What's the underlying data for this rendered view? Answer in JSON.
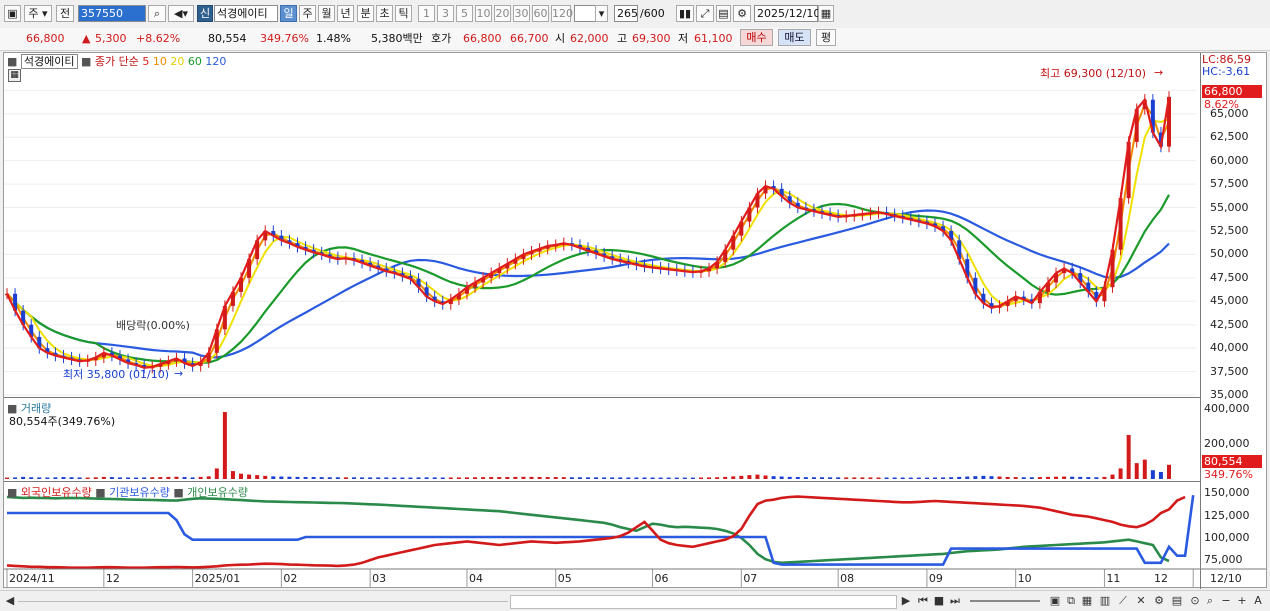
{
  "toolbar": {
    "type_label": "주",
    "prev_label": "전",
    "code_value": "357550",
    "sin_label": "신",
    "stock_name": "석경에이티",
    "periods": [
      "일",
      "주",
      "월",
      "년",
      "분",
      "초",
      "틱"
    ],
    "minutes": [
      "1",
      "3",
      "5",
      "10",
      "20",
      "30",
      "60",
      "120"
    ],
    "count_value": "265",
    "count_max": "/600",
    "date_value": "2025/12/10"
  },
  "quote": {
    "price": "66,800",
    "change": "5,300",
    "change_pct": "+8.62%",
    "volume": "80,554",
    "volume_ratio": "349.76%",
    "turnover_pct": "1.48%",
    "amount": "5,380백만",
    "hoga_label": "호가",
    "ask": "66,800",
    "bid": "66,700",
    "open_label": "시",
    "open": "62,000",
    "high_label": "고",
    "high": "69,300",
    "low_label": "저",
    "low": "61,100",
    "buy_label": "매수",
    "sell_label": "매도",
    "eval_label": "평"
  },
  "price_panel": {
    "title": "석경에이티",
    "ma_label": "종가 단순",
    "ma_periods": [
      "5",
      "10",
      "20",
      "60",
      "120"
    ],
    "ma_colors": [
      "#e01c1c",
      "#f08a00",
      "#f0e000",
      "#1a9a2a",
      "#2a5ae0"
    ],
    "lc_label": "LC:86,59",
    "hc_label": "HC:-3,61",
    "last_price_tag": "66,800",
    "last_pct_tag": "8.62%",
    "high_annotation": "최고 69,300 (12/10)",
    "low_annotation": "최저 35,800 (01/10)",
    "dividend_annotation": "배당락(0.00%)",
    "y_ticks": [
      "67,500",
      "65,000",
      "62,500",
      "60,000",
      "57,500",
      "55,000",
      "52,500",
      "50,000",
      "47,500",
      "45,000",
      "42,500",
      "40,000",
      "37,500",
      "35,000"
    ]
  },
  "volume_panel": {
    "title": "거래량",
    "value_label": "80,554주(349.76%)",
    "y_ticks": [
      "400,000",
      "200,000"
    ],
    "last_tag": "80,554",
    "last_pct_tag": "349.76%"
  },
  "holding_panel": {
    "legend": [
      "외국인보유수량",
      "기관보유수량",
      "개인보유수량"
    ],
    "colors": [
      "#d21a1a",
      "#2a5ae0",
      "#2a8a4a"
    ],
    "y_ticks": [
      "150,000",
      "125,000",
      "100,000",
      "75,000"
    ]
  },
  "x_axis": [
    "2024/11",
    "12",
    "2025/01",
    "02",
    "03",
    "04",
    "05",
    "06",
    "07",
    "08",
    "09",
    "10",
    "11",
    "12",
    "12/10"
  ],
  "chart_data": {
    "type": "line",
    "price_range": [
      35000,
      68500
    ],
    "volume_range": [
      0,
      420000
    ],
    "holding_range": [
      65000,
      155000
    ],
    "close": [
      45800,
      44000,
      42500,
      41200,
      40000,
      39500,
      39200,
      39000,
      38800,
      38600,
      38700,
      39000,
      39500,
      39200,
      38800,
      38400,
      38200,
      37900,
      38000,
      38300,
      38600,
      38900,
      38400,
      38100,
      38500,
      39500,
      42000,
      44500,
      46000,
      47500,
      49500,
      51500,
      52500,
      52000,
      51500,
      51200,
      50800,
      50500,
      50200,
      50000,
      49700,
      49500,
      49600,
      49400,
      49100,
      48800,
      48500,
      48200,
      48000,
      47700,
      47400,
      46500,
      45500,
      45000,
      44700,
      45200,
      45800,
      46500,
      47000,
      47500,
      48000,
      48500,
      49000,
      49500,
      50000,
      50300,
      50600,
      50900,
      51000,
      51200,
      51000,
      50700,
      50400,
      50100,
      49800,
      49500,
      49300,
      49100,
      48900,
      48700,
      48600,
      48500,
      48400,
      48300,
      48200,
      48100,
      48200,
      48500,
      49200,
      50500,
      52000,
      53500,
      55000,
      56500,
      57300,
      57000,
      56200,
      55500,
      55000,
      54800,
      54600,
      54400,
      54200,
      54000,
      54100,
      54200,
      54300,
      54400,
      54500,
      54300,
      54100,
      53900,
      53700,
      53500,
      53300,
      53000,
      52500,
      51500,
      49500,
      47500,
      45800,
      44800,
      44300,
      44500,
      45000,
      45500,
      45200,
      44800,
      46000,
      47000,
      48000,
      48500,
      48000,
      47000,
      46000,
      45000,
      46500,
      50500,
      56000,
      62000,
      65500,
      66500,
      63000,
      61500,
      66800
    ],
    "volume": [
      8000,
      9000,
      12000,
      10000,
      9000,
      8500,
      9500,
      11000,
      10000,
      9000,
      8000,
      9500,
      12000,
      11000,
      9000,
      8500,
      8000,
      9000,
      10000,
      11000,
      12000,
      13000,
      11000,
      9000,
      12000,
      15000,
      60000,
      380000,
      45000,
      30000,
      25000,
      22000,
      18000,
      15000,
      14000,
      13000,
      12000,
      11000,
      11000,
      10500,
      10000,
      10000,
      9500,
      9500,
      9000,
      9000,
      9000,
      9000,
      8500,
      8500,
      8500,
      9000,
      9500,
      9000,
      8500,
      8500,
      9000,
      9500,
      10000,
      10500,
      11000,
      11000,
      11500,
      12000,
      12500,
      12000,
      11500,
      11000,
      11000,
      10500,
      10000,
      10000,
      9500,
      9500,
      9000,
      9000,
      9000,
      8500,
      8500,
      8500,
      8500,
      8000,
      8000,
      8000,
      8000,
      8000,
      8500,
      9000,
      10000,
      12000,
      15000,
      18000,
      22000,
      25000,
      20000,
      16000,
      14000,
      12000,
      11000,
      10500,
      10000,
      10000,
      9500,
      9500,
      9000,
      9000,
      9000,
      9000,
      8500,
      8500,
      8500,
      8500,
      8000,
      8000,
      8000,
      8500,
      9000,
      10000,
      12000,
      14000,
      16000,
      18000,
      16000,
      14000,
      12000,
      11000,
      10000,
      10000,
      11000,
      12000,
      13000,
      14000,
      13000,
      12000,
      11000,
      10000,
      12000,
      25000,
      60000,
      250000,
      90000,
      110000,
      50000,
      40000,
      80554
    ],
    "foreign": [
      69000,
      68500,
      68000,
      67500,
      67500,
      67000,
      67000,
      66800,
      66500,
      66500,
      66500,
      66800,
      67000,
      67000,
      66800,
      66500,
      66500,
      66500,
      66800,
      67000,
      67000,
      67200,
      67000,
      66800,
      67000,
      67500,
      68000,
      69000,
      69500,
      69800,
      70000,
      70500,
      71000,
      70800,
      70500,
      70000,
      69800,
      69500,
      69200,
      69000,
      68800,
      68500,
      69000,
      70000,
      72000,
      75000,
      78000,
      80000,
      82000,
      84000,
      86000,
      88000,
      90000,
      92000,
      93000,
      94000,
      95000,
      96000,
      95000,
      94000,
      93000,
      92000,
      93000,
      94000,
      95000,
      96000,
      95500,
      95000,
      94500,
      95000,
      95500,
      96000,
      97000,
      98000,
      99000,
      100000,
      102000,
      106000,
      112000,
      118000,
      108000,
      98000,
      94000,
      92000,
      91000,
      90000,
      92000,
      94000,
      96000,
      98000,
      102000,
      110000,
      125000,
      138000,
      142000,
      143000,
      145000,
      146000,
      146500,
      146000,
      145500,
      145000,
      144500,
      144000,
      143500,
      143000,
      142500,
      142000,
      141500,
      141000,
      140500,
      140000,
      140000,
      140500,
      141000,
      141500,
      141000,
      140500,
      140000,
      139500,
      139000,
      138500,
      138000,
      137500,
      137000,
      136500,
      136000,
      135000,
      134000,
      132000,
      130000,
      128000,
      126000,
      125000,
      124000,
      122000,
      120000,
      118000,
      115000,
      113000,
      112000,
      115000,
      120000,
      128000,
      132000,
      142000,
      146000
    ],
    "institution": [
      128000,
      128000,
      128000,
      128000,
      128000,
      128000,
      128000,
      128000,
      128000,
      128000,
      128000,
      128000,
      128000,
      128000,
      128000,
      128000,
      128000,
      128000,
      128000,
      128000,
      128000,
      120000,
      104000,
      98000,
      98000,
      98000,
      98000,
      98000,
      98000,
      98000,
      98000,
      98000,
      98000,
      98000,
      98000,
      98000,
      98000,
      101000,
      101000,
      101000,
      101000,
      101000,
      101000,
      101000,
      101000,
      101000,
      101000,
      101000,
      101000,
      101000,
      101000,
      101000,
      101000,
      101000,
      101000,
      101000,
      101000,
      101000,
      101000,
      101000,
      101000,
      101000,
      101000,
      101000,
      101000,
      101000,
      101000,
      101000,
      101000,
      101000,
      101000,
      101000,
      101000,
      101000,
      101000,
      101000,
      101000,
      101000,
      101000,
      101000,
      101000,
      101000,
      101000,
      101000,
      101000,
      101000,
      101000,
      101000,
      101000,
      101000,
      101000,
      101000,
      101000,
      101000,
      101000,
      72000,
      70000,
      70000,
      70000,
      70000,
      70000,
      70000,
      70000,
      70000,
      70000,
      70000,
      70000,
      70000,
      70000,
      70000,
      70000,
      70000,
      70000,
      70000,
      70000,
      70000,
      70000,
      88000,
      88000,
      88000,
      88000,
      88000,
      88000,
      88000,
      88000,
      88000,
      88000,
      88000,
      88000,
      88000,
      88000,
      88000,
      88000,
      88000,
      88000,
      88000,
      88000,
      88000,
      88000,
      88000,
      88000,
      72000,
      72000,
      72000,
      90000,
      80000,
      80000,
      148000
    ],
    "individual": [
      146000,
      145500,
      145000,
      145200,
      145000,
      144800,
      144500,
      144800,
      145000,
      144800,
      144500,
      144200,
      144000,
      143800,
      143500,
      143200,
      143000,
      142800,
      142600,
      142400,
      142200,
      142000,
      143000,
      144000,
      144500,
      144200,
      144000,
      143500,
      143000,
      142500,
      142000,
      141500,
      141000,
      140800,
      140600,
      140400,
      140200,
      140000,
      139800,
      139600,
      139400,
      139200,
      139000,
      138600,
      138200,
      137800,
      137400,
      137000,
      136500,
      136000,
      135500,
      135000,
      134500,
      134000,
      133500,
      133000,
      132500,
      132000,
      131500,
      131000,
      130500,
      130000,
      129000,
      128000,
      127000,
      126000,
      125000,
      124000,
      123000,
      122000,
      121000,
      120000,
      119000,
      118000,
      117000,
      115000,
      112000,
      110000,
      108000,
      112000,
      116000,
      115000,
      113000,
      112000,
      112500,
      112000,
      111500,
      111000,
      110000,
      108000,
      105000,
      100000,
      92000,
      82000,
      76000,
      73000,
      72000,
      72500,
      73000,
      73500,
      74000,
      74500,
      75000,
      75500,
      76000,
      76500,
      77000,
      77500,
      78000,
      78500,
      79000,
      79500,
      80000,
      80500,
      81000,
      81500,
      82000,
      83000,
      84000,
      85000,
      85500,
      86000,
      86500,
      87000,
      88000,
      89000,
      90000,
      90500,
      91000,
      91500,
      92000,
      92500,
      93000,
      93500,
      94000,
      94500,
      95000,
      96000,
      97000,
      98000,
      96000,
      94000,
      92000,
      78000,
      74000
    ]
  }
}
